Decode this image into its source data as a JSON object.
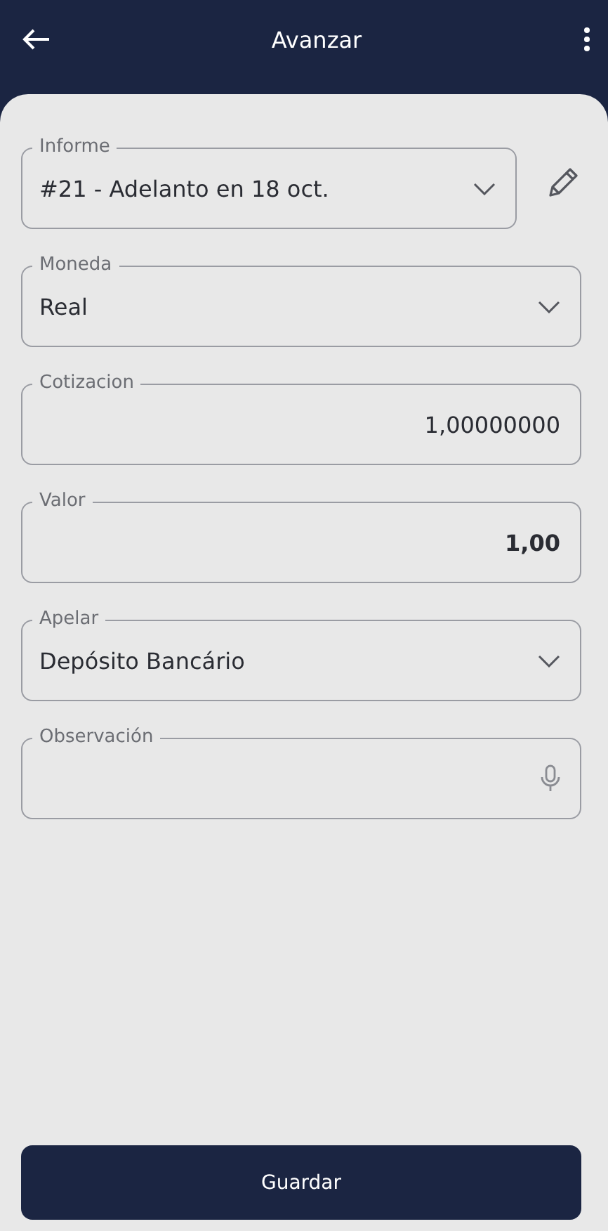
{
  "header": {
    "title": "Avanzar"
  },
  "fields": [
    {
      "kind": "select",
      "label": "Informe",
      "value": "#21 - Adelanto en 18 oct.",
      "editable": true
    },
    {
      "kind": "select",
      "label": "Moneda",
      "value": "Real"
    },
    {
      "kind": "number",
      "label": "Cotizacion",
      "value": "1,00000000"
    },
    {
      "kind": "amount",
      "label": "Valor",
      "value": "1,00"
    },
    {
      "kind": "select",
      "label": "Apelar",
      "value": "Depósito Bancário"
    },
    {
      "kind": "voice",
      "label": "Observación"
    }
  ],
  "save_button": {
    "label": "Guardar"
  }
}
